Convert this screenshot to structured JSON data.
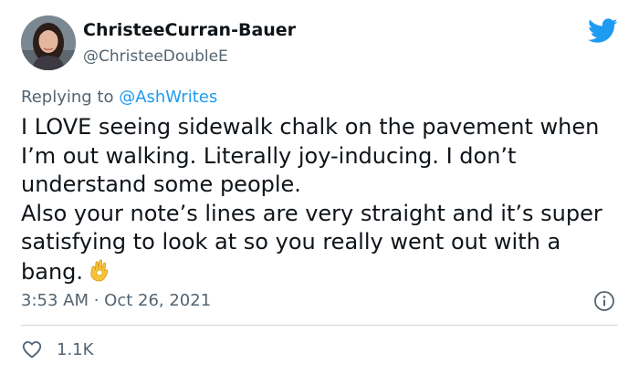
{
  "author": {
    "display_name": "ChristeeCurran-Bauer",
    "handle": "@ChristeeDoubleE"
  },
  "reply": {
    "prefix": "Replying to ",
    "mention": "@AshWrites"
  },
  "tweet": {
    "paragraph_1": "I LOVE seeing sidewalk chalk on the pavement when I’m out walking. Literally joy-inducing. I don’t understand some people.",
    "paragraph_2": "Also your note’s lines are very straight and it’s super satisfying to look at so you really went out with a bang.",
    "emoji_icon": "ok-hand-emoji-icon",
    "timestamp": "3:53 AM · Oct 26, 2021"
  },
  "engagement": {
    "likes": "1.1K"
  },
  "icons": {
    "brand": "twitter-bird-icon",
    "info": "info-icon",
    "like": "heart-icon"
  },
  "colors": {
    "accent": "#1d9bf0",
    "text": "#0f1419",
    "secondary": "#536471"
  }
}
